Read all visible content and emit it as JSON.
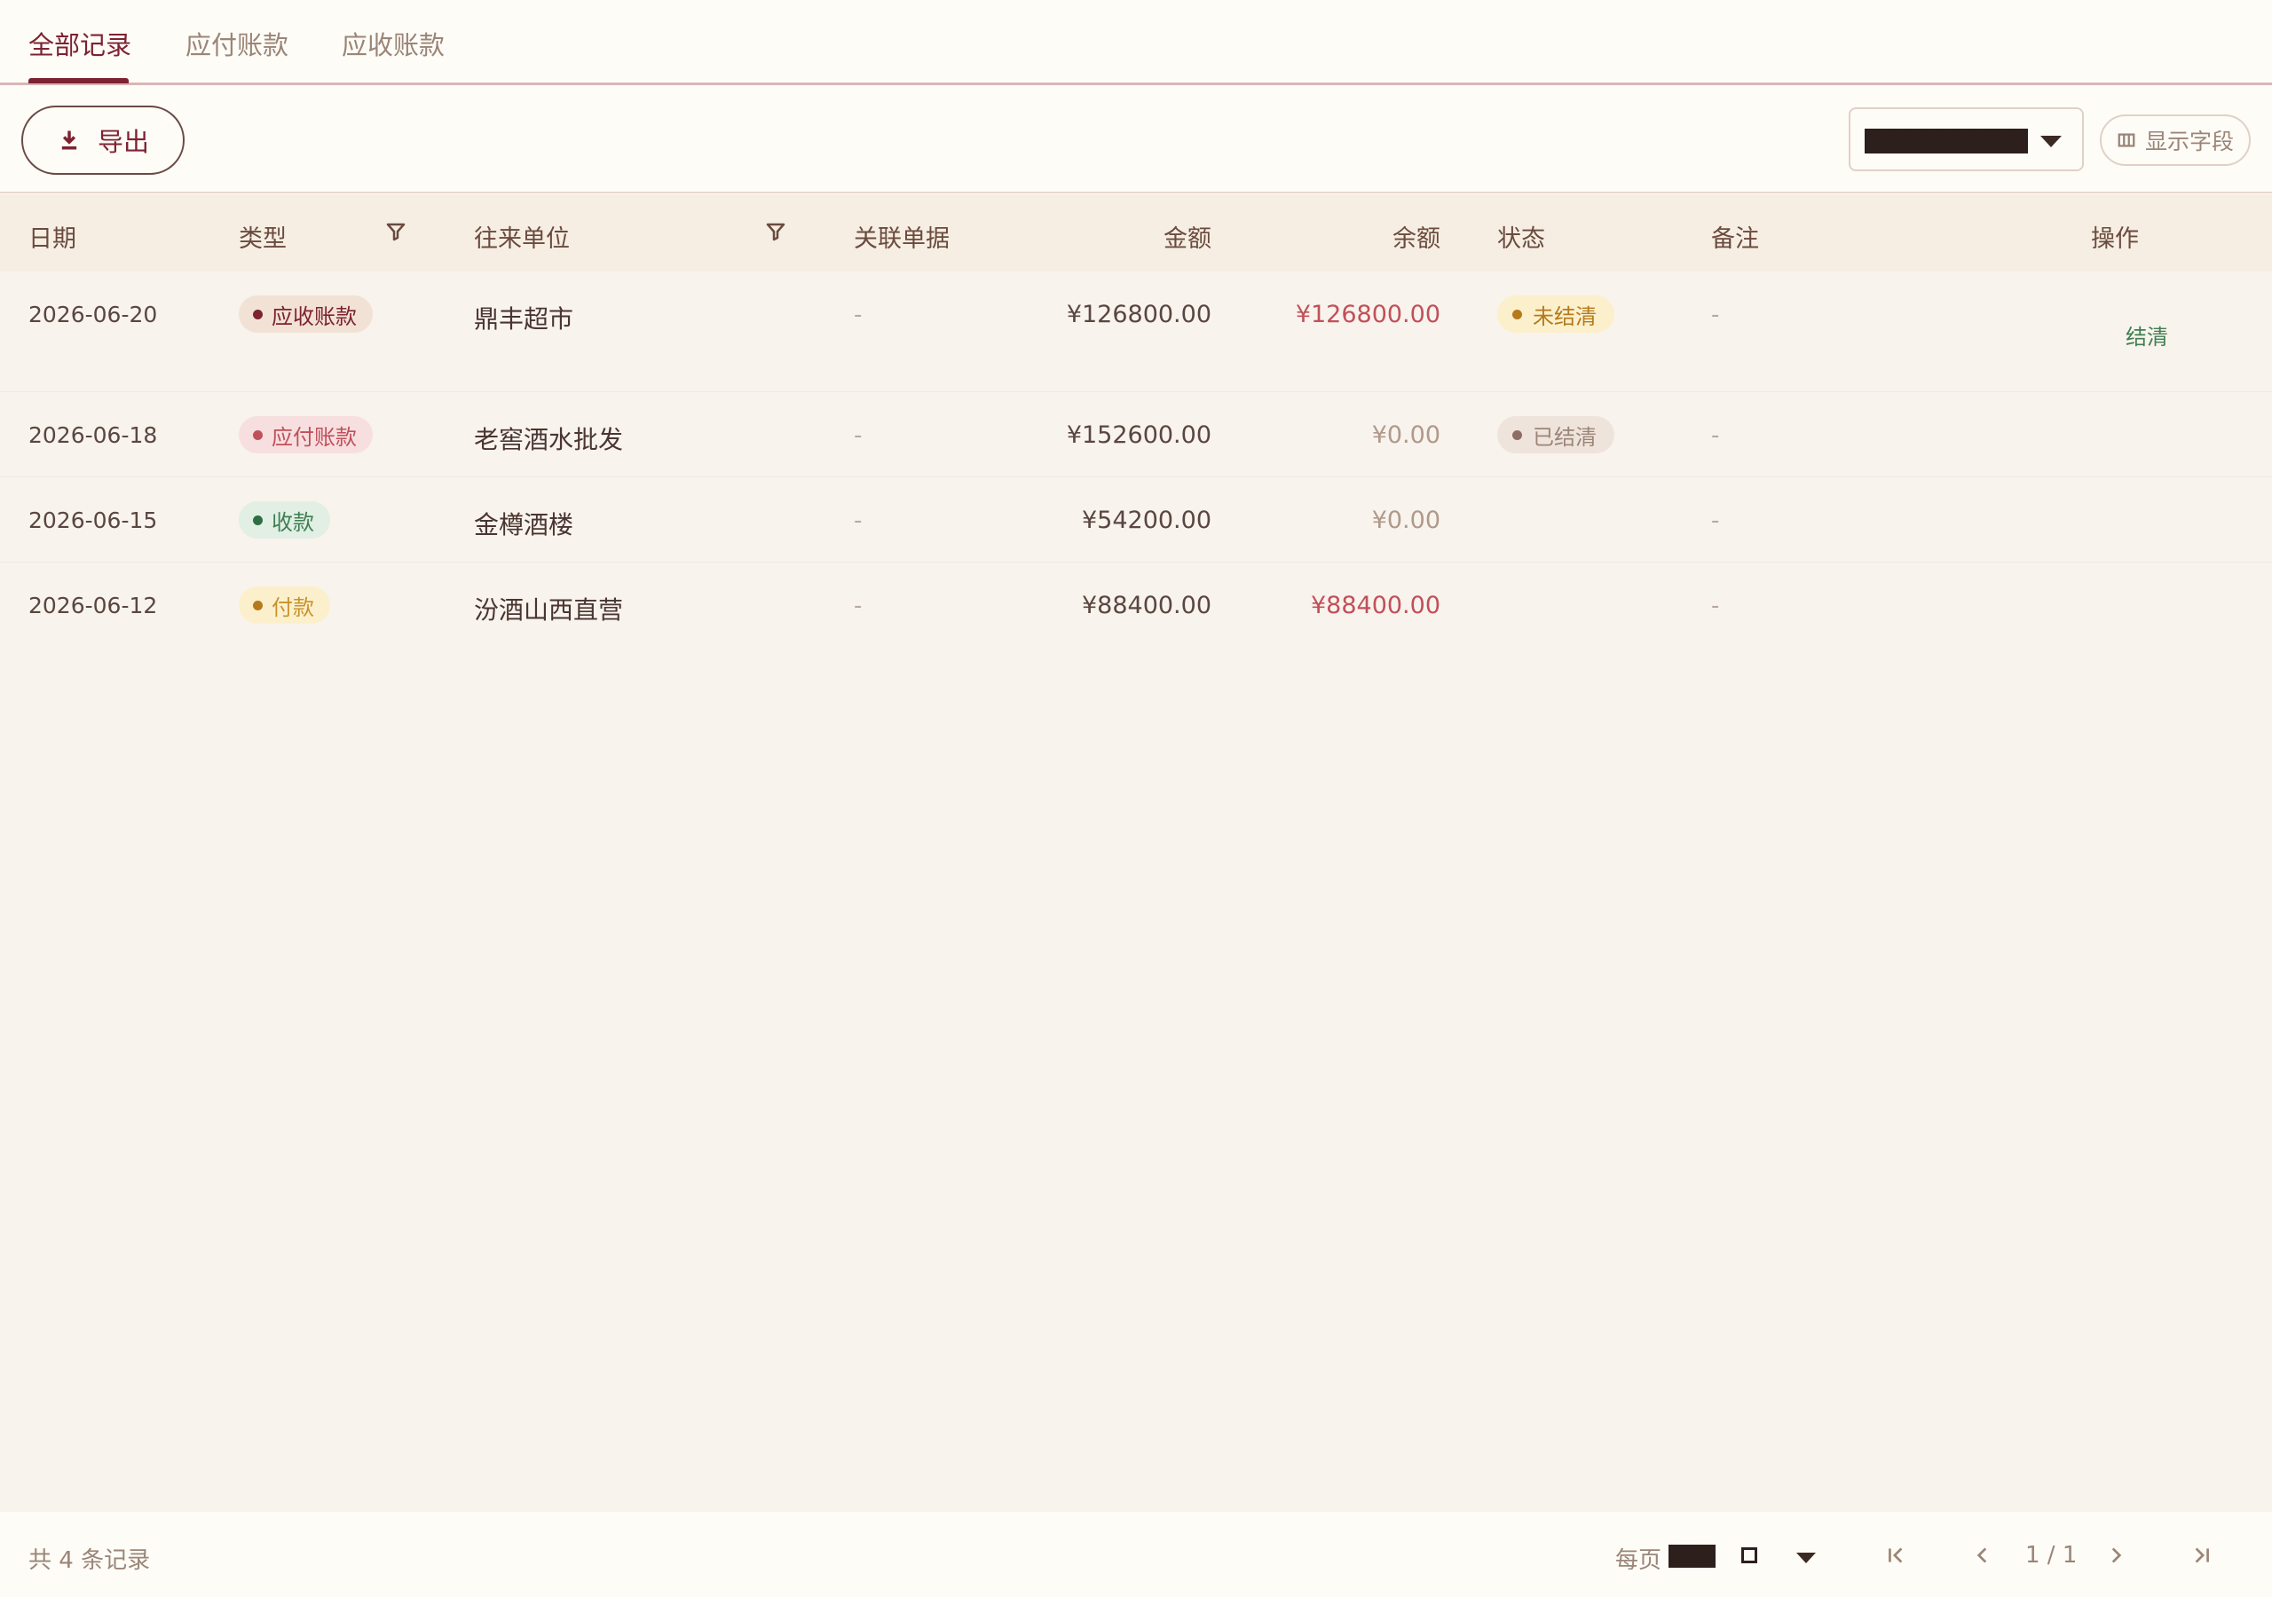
{
  "tabs": [
    {
      "label": "全部记录",
      "active": true
    },
    {
      "label": "应付账款",
      "active": false
    },
    {
      "label": "应收账款",
      "active": false
    }
  ],
  "toolbar": {
    "export_label": "导出",
    "select_value": "████████████",
    "fields_label": "显示字段"
  },
  "table": {
    "headers": {
      "date": "日期",
      "type": "类型",
      "party": "往来单位",
      "ref": "关联单据",
      "amount": "金额",
      "balance": "余额",
      "status": "状态",
      "note": "备注",
      "action": "操作"
    },
    "rows": [
      {
        "date": "2026-06-20",
        "type": "应收账款",
        "party": "鼎丰超市",
        "ref": "-",
        "amount": "¥126800.00",
        "balance": "¥126800.00",
        "status": "未结清",
        "note": "-",
        "action": "结清"
      },
      {
        "date": "2026-06-18",
        "type": "应付账款",
        "party": "老窖酒水批发",
        "ref": "-",
        "amount": "¥152600.00",
        "balance": "¥0.00",
        "status": "已结清",
        "note": "-",
        "action": ""
      },
      {
        "date": "2026-06-15",
        "type": "收款",
        "party": "金樽酒楼",
        "ref": "-",
        "amount": "¥54200.00",
        "balance": "¥0.00",
        "status": "",
        "note": "-",
        "action": ""
      },
      {
        "date": "2026-06-12",
        "type": "付款",
        "party": "汾酒山西直营",
        "ref": "-",
        "amount": "¥88400.00",
        "balance": "¥88400.00",
        "status": "",
        "note": "-",
        "action": ""
      }
    ]
  },
  "footer": {
    "total": "共 4 条记录",
    "per_page_label": "每页",
    "per_page_value": "███",
    "page_indicator": "1 / 1"
  },
  "colors": {
    "accent": "#7d2230",
    "balance_outstanding": "#c0505a",
    "balance_zero": "#b0998b",
    "action_green": "#3f7f52"
  }
}
